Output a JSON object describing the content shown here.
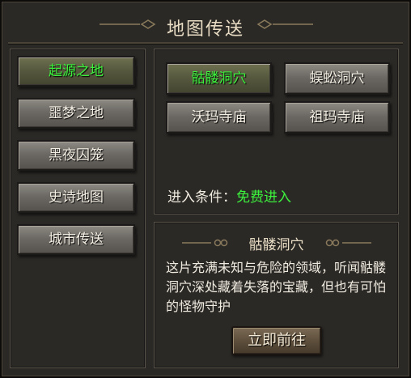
{
  "window": {
    "title": "地图传送"
  },
  "sidebar": {
    "items": [
      {
        "label": "起源之地",
        "selected": true
      },
      {
        "label": "噩梦之地",
        "selected": false
      },
      {
        "label": "黑夜囚笼",
        "selected": false
      },
      {
        "label": "史诗地图",
        "selected": false
      },
      {
        "label": "城市传送",
        "selected": false
      }
    ]
  },
  "destinations": {
    "items": [
      {
        "label": "骷髅洞穴",
        "selected": true
      },
      {
        "label": "蜈蚣洞穴",
        "selected": false
      },
      {
        "label": "沃玛寺庙",
        "selected": false
      },
      {
        "label": "祖玛寺庙",
        "selected": false
      }
    ],
    "condition_label": "进入条件：",
    "condition_value": "免费进入"
  },
  "detail": {
    "title": "骷髅洞穴",
    "description": "这片充满未知与危险的领域，听闻骷髅洞穴深处藏着失落的宝藏，但也有可怕的怪物守护",
    "go_label": "立即前往"
  },
  "colors": {
    "accent_green": "#3cf23c",
    "panel_bg": "#2b2926",
    "title_text": "#e8dcc4"
  }
}
